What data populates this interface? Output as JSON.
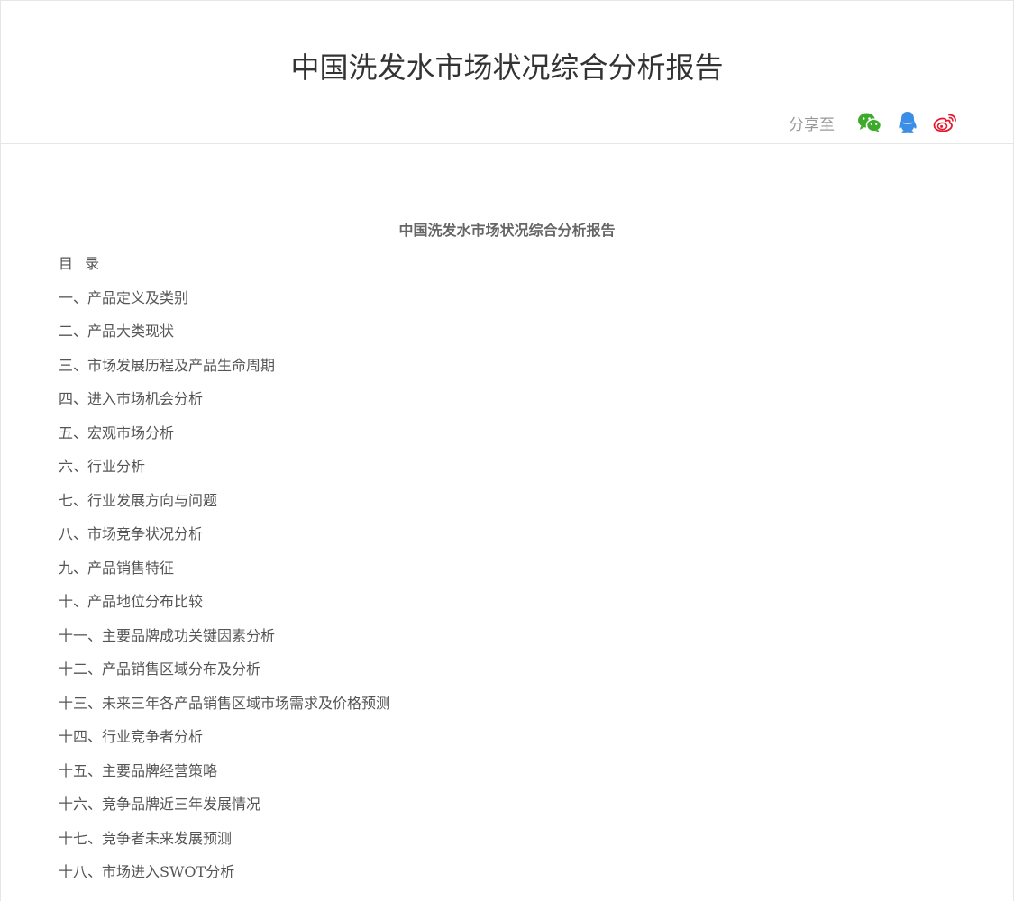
{
  "header": {
    "title": "中国洗发水市场状况综合分析报告",
    "share_label": "分享至",
    "share_buttons": [
      {
        "name": "wechat-icon",
        "color": "#3daa2b"
      },
      {
        "name": "qq-icon",
        "color": "#3a8ee6"
      },
      {
        "name": "weibo-icon",
        "color": "#e6162d"
      }
    ]
  },
  "article": {
    "title": "中国洗发水市场状况综合分析报告",
    "toc_heading": "目 录",
    "toc_items": [
      "一、产品定义及类别",
      "二、产品大类现状",
      "三、市场发展历程及产品生命周期",
      "四、进入市场机会分析",
      "五、宏观市场分析",
      "六、行业分析",
      "七、行业发展方向与问题",
      "八、市场竞争状况分析",
      "九、产品销售特征",
      "十、产品地位分布比较",
      "十一、主要品牌成功关键因素分析",
      "十二、产品销售区域分布及分析",
      "十三、未来三年各产品销售区域市场需求及价格预测",
      "十四、行业竞争者分析",
      "十五、主要品牌经营策略",
      "十六、竞争品牌近三年发展情况",
      "十七、竞争者未来发展预测",
      "十八、市场进入SWOT分析"
    ]
  }
}
